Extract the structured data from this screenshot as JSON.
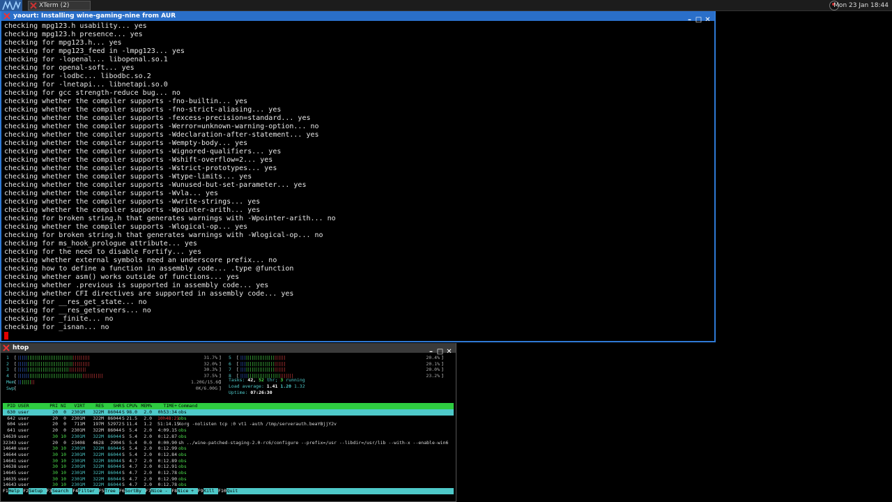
{
  "panel": {
    "task_title": "XTerm (2)",
    "clock": "Mon 23 Jan 18:44"
  },
  "terminal": {
    "title": "yaourt: Installing wine-gaming-nine from AUR",
    "lines": [
      "checking mpg123.h usability... yes",
      "checking mpg123.h presence... yes",
      "checking for mpg123.h... yes",
      "checking for mpg123_feed in -lmpg123... yes",
      "checking for -lopenal... libopenal.so.1",
      "checking for openal-soft... yes",
      "checking for -lodbc... libodbc.so.2",
      "checking for -lnetapi... libnetapi.so.0",
      "checking for gcc strength-reduce bug... no",
      "checking whether the compiler supports -fno-builtin... yes",
      "checking whether the compiler supports -fno-strict-aliasing... yes",
      "checking whether the compiler supports -fexcess-precision=standard... yes",
      "checking whether the compiler supports -Werror=unknown-warning-option... no",
      "checking whether the compiler supports -Wdeclaration-after-statement... yes",
      "checking whether the compiler supports -Wempty-body... yes",
      "checking whether the compiler supports -Wignored-qualifiers... yes",
      "checking whether the compiler supports -Wshift-overflow=2... yes",
      "checking whether the compiler supports -Wstrict-prototypes... yes",
      "checking whether the compiler supports -Wtype-limits... yes",
      "checking whether the compiler supports -Wunused-but-set-parameter... yes",
      "checking whether the compiler supports -Wvla... yes",
      "checking whether the compiler supports -Wwrite-strings... yes",
      "checking whether the compiler supports -Wpointer-arith... yes",
      "checking for broken string.h that generates warnings with -Wpointer-arith... no",
      "checking whether the compiler supports -Wlogical-op... yes",
      "checking for broken string.h that generates warnings with -Wlogical-op... no",
      "checking for ms_hook_prologue attribute... yes",
      "checking for the need to disable Fortify... yes",
      "checking whether external symbols need an underscore prefix... no",
      "checking how to define a function in assembly code... .type @function",
      "checking whether asm() works outside of functions... yes",
      "checking whether .previous is supported in assembly code... yes",
      "checking whether CFI directives are supported in assembly code... yes",
      "checking for __res_get_state... no",
      "checking for __res_getservers... no",
      "checking for _finite... no",
      "checking for _isnan... no"
    ]
  },
  "htop": {
    "title": "htop",
    "cpus": [
      {
        "num": "1",
        "pct": "31.7%",
        "usage": 0.317
      },
      {
        "num": "2",
        "pct": "32.0%",
        "usage": 0.32
      },
      {
        "num": "3",
        "pct": "30.3%",
        "usage": 0.303
      },
      {
        "num": "4",
        "pct": "37.5%",
        "usage": 0.375
      },
      {
        "num": "5",
        "pct": "20.4%",
        "usage": 0.204
      },
      {
        "num": "6",
        "pct": "20.1%",
        "usage": 0.201
      },
      {
        "num": "7",
        "pct": "20.0%",
        "usage": 0.2
      },
      {
        "num": "8",
        "pct": "23.2%",
        "usage": 0.232
      }
    ],
    "mem": {
      "label": "Mem",
      "value": "1.20G/15.6G",
      "usage": 0.077
    },
    "swp": {
      "label": "Swp",
      "value": "0K/6.00G",
      "usage": 0
    },
    "tasks": {
      "label": "Tasks:",
      "count": "42,",
      "thr": "52",
      "thr_label": "thr;",
      "running": "3",
      "running_label": "running"
    },
    "load": {
      "label": "Load average:",
      "v1": "1.41",
      "v5": "1.20",
      "v15": "1.32"
    },
    "uptime": {
      "label": "Uptime:",
      "value": "07:26:30"
    },
    "columns": [
      "PID",
      "USER",
      "PRI",
      "NI",
      "VIRT",
      "RES",
      "SHR",
      "S",
      "CPU%",
      "MEM%",
      "TIME+",
      "Command"
    ],
    "processes": [
      {
        "pid": "630",
        "user": "user",
        "pri": "20",
        "ni": "0",
        "virt": "2301M",
        "res": "322M",
        "shr": "86044",
        "s": "S",
        "cpu": "98.0",
        "mem": "2.0",
        "time": "0h53:34",
        "cmd": "obs"
      },
      {
        "pid": "642",
        "user": "user",
        "pri": "20",
        "ni": "0",
        "virt": "2301M",
        "res": "322M",
        "shr": "86044",
        "s": "S",
        "cpu": "21.5",
        "mem": "2.0",
        "time": "10h48:21",
        "cmd": "obs"
      },
      {
        "pid": "604",
        "user": "user",
        "pri": "20",
        "ni": "0",
        "virt": "711M",
        "res": "197M",
        "shr": "52972",
        "s": "S",
        "cpu": "11.4",
        "mem": "1.2",
        "time": "51:14.15",
        "cmd": "Xorg -nolisten tcp :0 vt1 -auth /tmp/serverauth.beaYBjjY2v"
      },
      {
        "pid": "641",
        "user": "user",
        "pri": "20",
        "ni": "0",
        "virt": "2301M",
        "res": "322M",
        "shr": "86044",
        "s": "S",
        "cpu": "5.4",
        "mem": "2.0",
        "time": "4:09.15",
        "cmd": "obs"
      },
      {
        "pid": "14639",
        "user": "user",
        "pri": "30",
        "ni": "10",
        "virt": "2301M",
        "res": "322M",
        "shr": "86044",
        "s": "S",
        "cpu": "5.4",
        "mem": "2.0",
        "time": "0:12.87",
        "cmd": "obs"
      },
      {
        "pid": "32343",
        "user": "user",
        "pri": "20",
        "ni": "0",
        "virt": "23408",
        "res": "4628",
        "shr": "2904",
        "s": "S",
        "cpu": "5.4",
        "mem": "0.0",
        "time": "0:00.90",
        "cmd": "sh ../wine-patched-staging-2.0-rc6/configure --prefix=/usr --libdir=/usr/lib --with-x --enable-win6"
      },
      {
        "pid": "14640",
        "user": "user",
        "pri": "30",
        "ni": "10",
        "virt": "2301M",
        "res": "322M",
        "shr": "86044",
        "s": "S",
        "cpu": "5.4",
        "mem": "2.0",
        "time": "0:12.99",
        "cmd": "obs"
      },
      {
        "pid": "14644",
        "user": "user",
        "pri": "30",
        "ni": "10",
        "virt": "2301M",
        "res": "322M",
        "shr": "86044",
        "s": "S",
        "cpu": "5.4",
        "mem": "2.0",
        "time": "0:12.84",
        "cmd": "obs"
      },
      {
        "pid": "14641",
        "user": "user",
        "pri": "30",
        "ni": "10",
        "virt": "2301M",
        "res": "322M",
        "shr": "86044",
        "s": "S",
        "cpu": "4.7",
        "mem": "2.0",
        "time": "0:12.89",
        "cmd": "obs"
      },
      {
        "pid": "14638",
        "user": "user",
        "pri": "30",
        "ni": "10",
        "virt": "2301M",
        "res": "322M",
        "shr": "86044",
        "s": "S",
        "cpu": "4.7",
        "mem": "2.0",
        "time": "0:12.91",
        "cmd": "obs"
      },
      {
        "pid": "14645",
        "user": "user",
        "pri": "30",
        "ni": "10",
        "virt": "2301M",
        "res": "322M",
        "shr": "86044",
        "s": "S",
        "cpu": "4.7",
        "mem": "2.0",
        "time": "0:12.78",
        "cmd": "obs"
      },
      {
        "pid": "14635",
        "user": "user",
        "pri": "30",
        "ni": "10",
        "virt": "2301M",
        "res": "322M",
        "shr": "86044",
        "s": "S",
        "cpu": "4.7",
        "mem": "2.0",
        "time": "0:12.90",
        "cmd": "obs"
      },
      {
        "pid": "14643",
        "user": "user",
        "pri": "30",
        "ni": "10",
        "virt": "2301M",
        "res": "322M",
        "shr": "86044",
        "s": "S",
        "cpu": "4.7",
        "mem": "2.0",
        "time": "0:12.78",
        "cmd": "obs"
      }
    ],
    "fkeys": [
      {
        "key": "F1",
        "label": "Help"
      },
      {
        "key": "F2",
        "label": "Setup"
      },
      {
        "key": "F3",
        "label": "Search"
      },
      {
        "key": "F4",
        "label": "Filter"
      },
      {
        "key": "F5",
        "label": "Tree"
      },
      {
        "key": "F6",
        "label": "SortBy"
      },
      {
        "key": "F7",
        "label": "Nice -"
      },
      {
        "key": "F8",
        "label": "Nice +"
      },
      {
        "key": "F9",
        "label": "Kill"
      },
      {
        "key": "F10",
        "label": "Quit"
      }
    ]
  },
  "colors": {
    "accent": "#2a6fc9",
    "htop_header": "#2ecc40",
    "htop_select": "#4ec9c9",
    "cursor": "#e00000"
  },
  "icons": [
    "menu-icon",
    "xterm-icon",
    "clock-icon",
    "minimize-icon",
    "maximize-icon",
    "close-icon"
  ]
}
